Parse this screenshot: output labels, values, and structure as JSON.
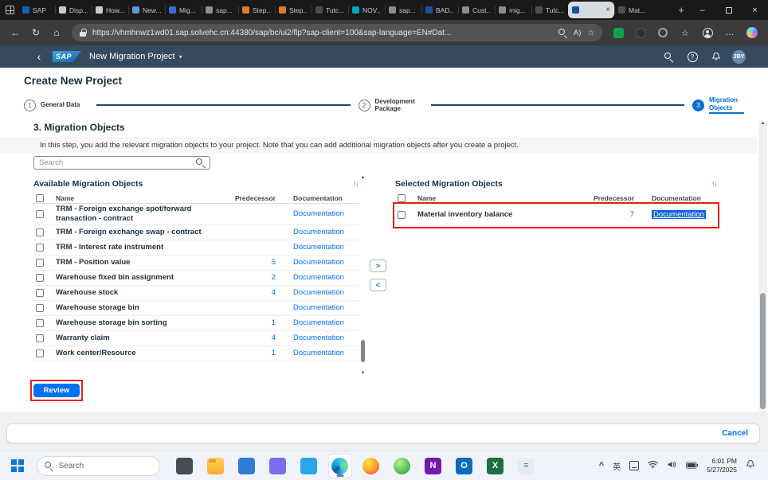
{
  "browser": {
    "tabs": [
      {
        "label": "SAP",
        "favicon": "#1464ac"
      },
      {
        "label": "Disp...",
        "favicon": "#c9ccd0"
      },
      {
        "label": "How...",
        "favicon": "#c9ccd0"
      },
      {
        "label": "New...",
        "favicon": "#5a9bd5"
      },
      {
        "label": "Mig...",
        "favicon": "#2f6fd0"
      },
      {
        "label": "sap...",
        "favicon": "#8a8f94"
      },
      {
        "label": "Step...",
        "favicon": "#e07a28"
      },
      {
        "label": "Step...",
        "favicon": "#e07a28"
      },
      {
        "label": "Tutc...",
        "favicon": "#4a4f54"
      },
      {
        "label": "NOV...",
        "favicon": "#0aa2c0"
      },
      {
        "label": "sap...",
        "favicon": "#8a8f94"
      },
      {
        "label": "BAD...",
        "favicon": "#1a4f9c"
      },
      {
        "label": "Cust...",
        "favicon": "#8a8f94"
      },
      {
        "label": "mig...",
        "favicon": "#8a8f94"
      },
      {
        "label": "Tutc...",
        "favicon": "#4a4f54"
      },
      {
        "label": "",
        "favicon": "#1a4f9c",
        "active": true
      },
      {
        "label": "Mat...",
        "favicon": "#4a4f54"
      }
    ],
    "new_tab": "+",
    "url": "https://vhmhnwz1wd01.sap.solvehc.cn:44380/sap/bc/ui2/flp?sap-client=100&sap-language=EN#Dat...",
    "window": {
      "minimize": "–",
      "close": "×"
    }
  },
  "icons": {
    "back": "←",
    "refresh": "↻",
    "home": "⌂",
    "star": "☆",
    "more": "…",
    "read_aloud": "A)",
    "caret_down": "▾",
    "chevron_left": "‹",
    "question": "?",
    "sort": "↑↓",
    "scroll_up": "▲",
    "scroll_down": "▼",
    "move_right": ">",
    "move_left": "<",
    "tray_chevron": "^",
    "close": "×"
  },
  "shell": {
    "logo": "SAP",
    "title": "New Migration Project",
    "avatar": "JBY"
  },
  "wizard": {
    "heading": "Create New Project",
    "steps": [
      {
        "num": "1",
        "label": "General Data"
      },
      {
        "num": "2",
        "label": "Development Package"
      },
      {
        "num": "3",
        "label": "Migration Objects",
        "active": true
      }
    ]
  },
  "content": {
    "section_title": "3. Migration Objects",
    "description": "In this step, you add the relevant migration objects to your project. Note that you can add additional migration objects after you create a project.",
    "search_placeholder": "Search",
    "available": {
      "title": "Available Migration Objects",
      "columns": [
        "Name",
        "Predecessor",
        "Documentation"
      ],
      "rows": [
        {
          "name": "TRM - Foreign exchange spot/forward transaction - contract",
          "predecessor": "",
          "documentation": "Documentation"
        },
        {
          "name": "TRM - Foreign exchange swap - contract",
          "predecessor": "",
          "documentation": "Documentation"
        },
        {
          "name": "TRM - Interest rate instrument",
          "predecessor": "",
          "documentation": "Documentation"
        },
        {
          "name": "TRM - Position value",
          "predecessor": "5",
          "documentation": "Documentation"
        },
        {
          "name": "Warehouse fixed bin assignment",
          "predecessor": "2",
          "documentation": "Documentation"
        },
        {
          "name": "Warehouse stock",
          "predecessor": "4",
          "documentation": "Documentation"
        },
        {
          "name": "Warehouse storage bin",
          "predecessor": "",
          "documentation": "Documentation"
        },
        {
          "name": "Warehouse storage bin sorting",
          "predecessor": "1",
          "documentation": "Documentation"
        },
        {
          "name": "Warranty claim",
          "predecessor": "4",
          "documentation": "Documentation"
        },
        {
          "name": "Work center/Resource",
          "predecessor": "1",
          "documentation": "Documentation"
        }
      ]
    },
    "selected": {
      "title": "Selected Migration Objects",
      "columns": [
        "Name",
        "Predecessor",
        "Documentation"
      ],
      "rows": [
        {
          "name": "Material inventory balance",
          "predecessor": "7",
          "documentation": "Documentation"
        }
      ]
    },
    "review_label": "Review",
    "cancel_label": "Cancel"
  },
  "taskbar": {
    "search_placeholder": "Search",
    "apps": [
      {
        "cls": "app-dark",
        "glyph": ""
      },
      {
        "cls": "app-folder",
        "glyph": ""
      },
      {
        "cls": "app-blue",
        "glyph": ""
      },
      {
        "cls": "app-purple",
        "glyph": ""
      },
      {
        "cls": "app-teal",
        "glyph": ""
      },
      {
        "cls": "app-edge",
        "glyph": "",
        "active": true
      },
      {
        "cls": "app-firefox",
        "glyph": ""
      },
      {
        "cls": "app-green",
        "glyph": ""
      },
      {
        "cls": "app-onenote",
        "glyph": "N"
      },
      {
        "cls": "app-outlook",
        "glyph": "O"
      },
      {
        "cls": "app-excel",
        "glyph": "X"
      },
      {
        "cls": "app-lines",
        "glyph": "≡"
      }
    ],
    "tray": {
      "ime": "英",
      "time": "6:01 PM",
      "date": "5/27/2025"
    }
  },
  "colors": {
    "accent": "#0070f2",
    "shell": "#354a5f",
    "annotation": "#ea1d12"
  }
}
